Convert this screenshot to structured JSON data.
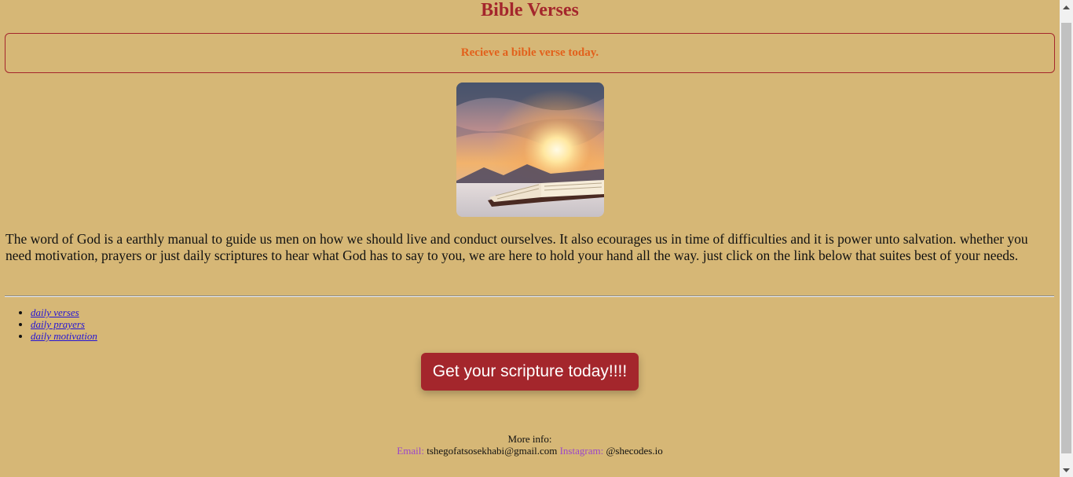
{
  "header": {
    "title": "Bible Verses"
  },
  "banner": {
    "text": "Recieve a bible verse today."
  },
  "hero": {
    "image_icon": "open-bible-sunrise-image"
  },
  "intro": {
    "text": "The word of God is a earthly manual to guide us men on how we should live and conduct ourselves. It also ecourages us in time of difficulties and it is power unto salvation. whether you need motivation, prayers or just daily scriptures to hear what God has to say to you, we are here to hold your hand all the way. just click on the link below that suites best of your needs."
  },
  "links": {
    "items": [
      {
        "label": "daily verses"
      },
      {
        "label": "daily prayers"
      },
      {
        "label": "daily motivation"
      }
    ]
  },
  "cta": {
    "label": "Get your scripture today!!!!"
  },
  "footer": {
    "more_info": "More info:",
    "email_label": "Email:",
    "email_value": "tshegofatsosekhabi@gmail.com",
    "instagram_label": "Instagram:",
    "instagram_value": "@shecodes.io"
  },
  "colors": {
    "background": "#d6b776",
    "accent": "#a4262c",
    "banner_text": "#e2611c",
    "footer_label": "#9b45c9"
  }
}
